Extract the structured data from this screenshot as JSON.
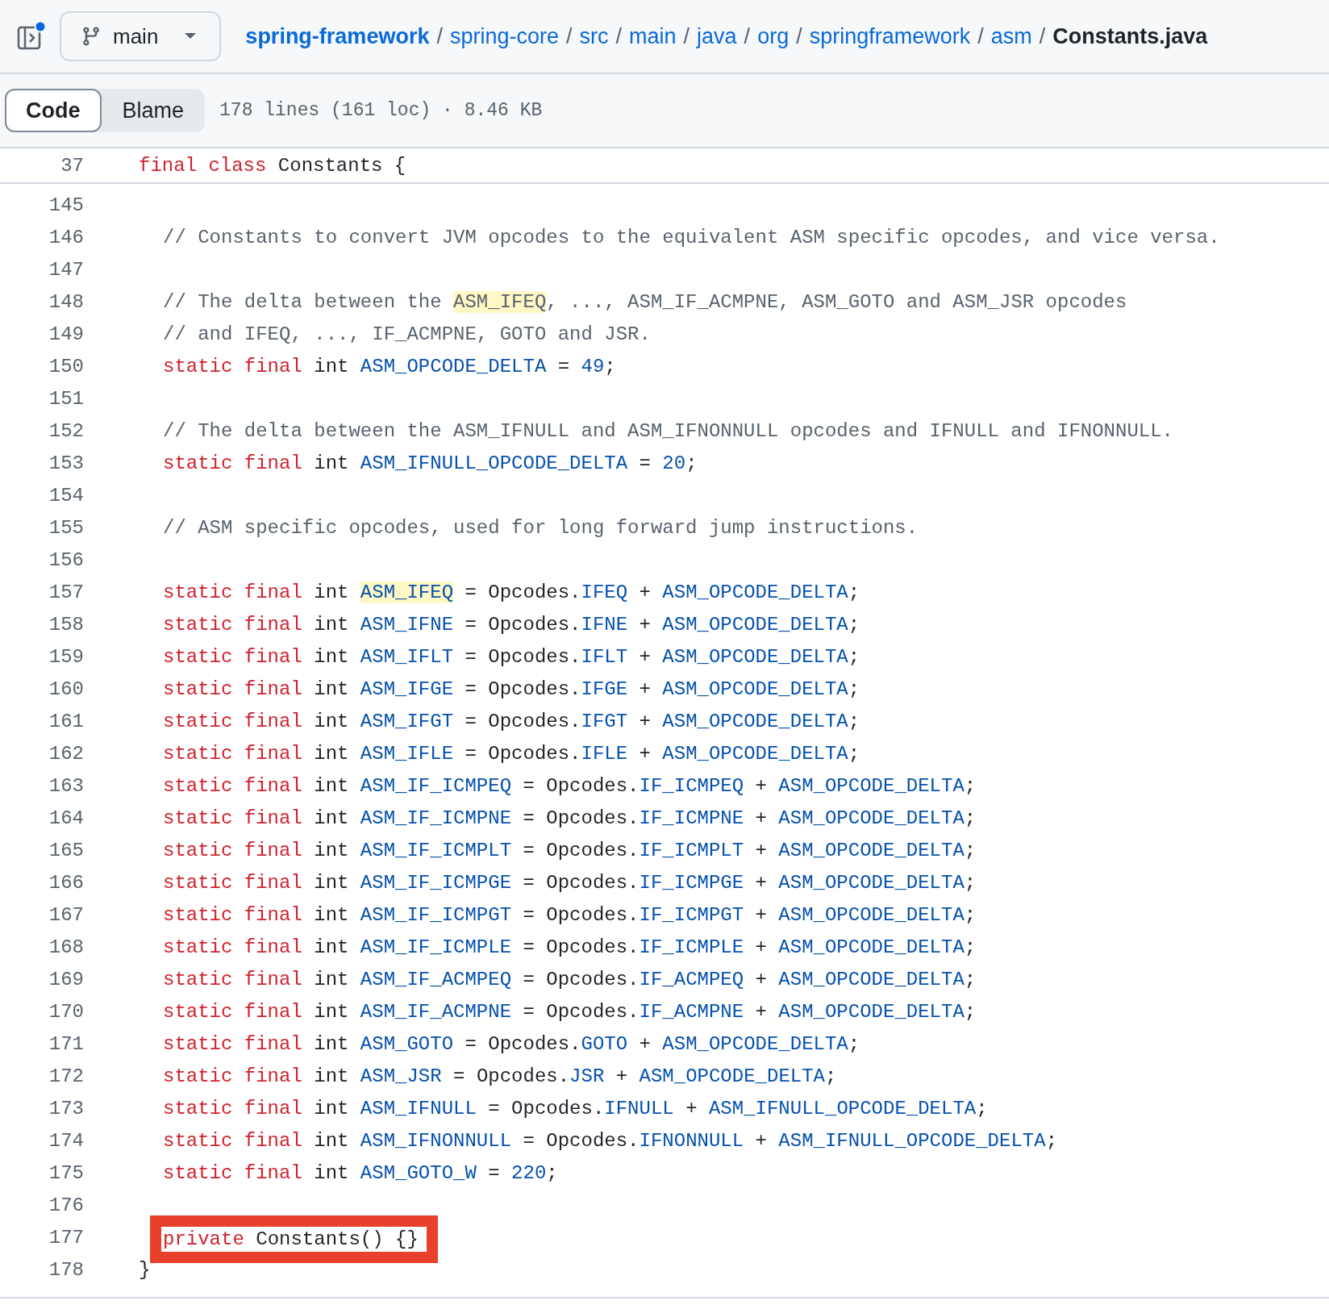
{
  "header": {
    "branch": {
      "label": "main"
    },
    "breadcrumb": [
      {
        "kind": "repo",
        "text": "spring-framework"
      },
      {
        "kind": "sep",
        "text": "/"
      },
      {
        "kind": "dir",
        "text": "spring-core"
      },
      {
        "kind": "sep",
        "text": "/"
      },
      {
        "kind": "dir",
        "text": "src"
      },
      {
        "kind": "sep",
        "text": "/"
      },
      {
        "kind": "dir",
        "text": "main"
      },
      {
        "kind": "sep",
        "text": "/"
      },
      {
        "kind": "dir",
        "text": "java"
      },
      {
        "kind": "sep",
        "text": "/"
      },
      {
        "kind": "dir",
        "text": "org"
      },
      {
        "kind": "sep",
        "text": "/"
      },
      {
        "kind": "dir",
        "text": "springframework"
      },
      {
        "kind": "sep",
        "text": "/"
      },
      {
        "kind": "dir",
        "text": "asm"
      },
      {
        "kind": "sep",
        "text": "/"
      },
      {
        "kind": "file",
        "text": "Constants.java"
      }
    ]
  },
  "tabs": [
    {
      "label": "Code",
      "selected": true
    },
    {
      "label": "Blame",
      "selected": false
    }
  ],
  "file_info": "178 lines (161 loc) · 8.46 KB",
  "sticky_line": {
    "number": "37",
    "tokens": [
      {
        "kind": "kw",
        "text": "final class"
      },
      {
        "kind": "plain",
        "text": " Constants {"
      }
    ]
  },
  "lines": [
    {
      "number": "145",
      "kind": "body"
    },
    {
      "number": "146",
      "kind": "body",
      "tokens": [
        {
          "kind": "comment",
          "text": "// Constants to convert JVM opcodes to the equivalent ASM specific opcodes, and vice versa."
        }
      ]
    },
    {
      "number": "147",
      "kind": "body"
    },
    {
      "number": "148",
      "kind": "body",
      "tokens": [
        {
          "kind": "comment",
          "text": "// The delta between the "
        },
        {
          "kind": "comment",
          "text": "ASM_IFEQ",
          "highlighted": true
        },
        {
          "kind": "comment",
          "text": ", ..., ASM_IF_ACMPNE, ASM_GOTO and ASM_JSR opcodes"
        }
      ]
    },
    {
      "number": "149",
      "kind": "body",
      "tokens": [
        {
          "kind": "comment",
          "text": "// and IFEQ, ..., IF_ACMPNE, GOTO and JSR."
        }
      ]
    },
    {
      "number": "150",
      "kind": "body",
      "tokens": [
        {
          "kind": "kw",
          "text": "static final"
        },
        {
          "kind": "plain",
          "text": " int "
        },
        {
          "kind": "const",
          "text": "ASM_OPCODE_DELTA"
        },
        {
          "kind": "plain",
          "text": " = "
        },
        {
          "kind": "const",
          "text": "49"
        },
        {
          "kind": "plain",
          "text": ";"
        }
      ]
    },
    {
      "number": "151",
      "kind": "body"
    },
    {
      "number": "152",
      "kind": "body",
      "tokens": [
        {
          "kind": "comment",
          "text": "// The delta between the ASM_IFNULL and ASM_IFNONNULL opcodes and IFNULL and IFNONNULL."
        }
      ]
    },
    {
      "number": "153",
      "kind": "body",
      "tokens": [
        {
          "kind": "kw",
          "text": "static final"
        },
        {
          "kind": "plain",
          "text": " int "
        },
        {
          "kind": "const",
          "text": "ASM_IFNULL_OPCODE_DELTA"
        },
        {
          "kind": "plain",
          "text": " = "
        },
        {
          "kind": "const",
          "text": "20"
        },
        {
          "kind": "plain",
          "text": ";"
        }
      ]
    },
    {
      "number": "154",
      "kind": "body"
    },
    {
      "number": "155",
      "kind": "body",
      "tokens": [
        {
          "kind": "comment",
          "text": "// ASM specific opcodes, used for long forward jump instructions."
        }
      ]
    },
    {
      "number": "156",
      "kind": "body"
    },
    {
      "number": "157",
      "kind": "body",
      "tokens": [
        {
          "kind": "kw",
          "text": "static final"
        },
        {
          "kind": "plain",
          "text": " int "
        },
        {
          "kind": "const",
          "text": "ASM_IFEQ",
          "highlighted": true
        },
        {
          "kind": "plain",
          "text": " = Opcodes."
        },
        {
          "kind": "const",
          "text": "IFEQ"
        },
        {
          "kind": "plain",
          "text": " + "
        },
        {
          "kind": "const",
          "text": "ASM_OPCODE_DELTA"
        },
        {
          "kind": "plain",
          "text": ";"
        }
      ]
    },
    {
      "number": "158",
      "kind": "body",
      "tokens": [
        {
          "kind": "kw",
          "text": "static final"
        },
        {
          "kind": "plain",
          "text": " int "
        },
        {
          "kind": "const",
          "text": "ASM_IFNE"
        },
        {
          "kind": "plain",
          "text": " = Opcodes."
        },
        {
          "kind": "const",
          "text": "IFNE"
        },
        {
          "kind": "plain",
          "text": " + "
        },
        {
          "kind": "const",
          "text": "ASM_OPCODE_DELTA"
        },
        {
          "kind": "plain",
          "text": ";"
        }
      ]
    },
    {
      "number": "159",
      "kind": "body",
      "tokens": [
        {
          "kind": "kw",
          "text": "static final"
        },
        {
          "kind": "plain",
          "text": " int "
        },
        {
          "kind": "const",
          "text": "ASM_IFLT"
        },
        {
          "kind": "plain",
          "text": " = Opcodes."
        },
        {
          "kind": "const",
          "text": "IFLT"
        },
        {
          "kind": "plain",
          "text": " + "
        },
        {
          "kind": "const",
          "text": "ASM_OPCODE_DELTA"
        },
        {
          "kind": "plain",
          "text": ";"
        }
      ]
    },
    {
      "number": "160",
      "kind": "body",
      "tokens": [
        {
          "kind": "kw",
          "text": "static final"
        },
        {
          "kind": "plain",
          "text": " int "
        },
        {
          "kind": "const",
          "text": "ASM_IFGE"
        },
        {
          "kind": "plain",
          "text": " = Opcodes."
        },
        {
          "kind": "const",
          "text": "IFGE"
        },
        {
          "kind": "plain",
          "text": " + "
        },
        {
          "kind": "const",
          "text": "ASM_OPCODE_DELTA"
        },
        {
          "kind": "plain",
          "text": ";"
        }
      ]
    },
    {
      "number": "161",
      "kind": "body",
      "tokens": [
        {
          "kind": "kw",
          "text": "static final"
        },
        {
          "kind": "plain",
          "text": " int "
        },
        {
          "kind": "const",
          "text": "ASM_IFGT"
        },
        {
          "kind": "plain",
          "text": " = Opcodes."
        },
        {
          "kind": "const",
          "text": "IFGT"
        },
        {
          "kind": "plain",
          "text": " + "
        },
        {
          "kind": "const",
          "text": "ASM_OPCODE_DELTA"
        },
        {
          "kind": "plain",
          "text": ";"
        }
      ]
    },
    {
      "number": "162",
      "kind": "body",
      "tokens": [
        {
          "kind": "kw",
          "text": "static final"
        },
        {
          "kind": "plain",
          "text": " int "
        },
        {
          "kind": "const",
          "text": "ASM_IFLE"
        },
        {
          "kind": "plain",
          "text": " = Opcodes."
        },
        {
          "kind": "const",
          "text": "IFLE"
        },
        {
          "kind": "plain",
          "text": " + "
        },
        {
          "kind": "const",
          "text": "ASM_OPCODE_DELTA"
        },
        {
          "kind": "plain",
          "text": ";"
        }
      ]
    },
    {
      "number": "163",
      "kind": "body",
      "tokens": [
        {
          "kind": "kw",
          "text": "static final"
        },
        {
          "kind": "plain",
          "text": " int "
        },
        {
          "kind": "const",
          "text": "ASM_IF_ICMPEQ"
        },
        {
          "kind": "plain",
          "text": " = Opcodes."
        },
        {
          "kind": "const",
          "text": "IF_ICMPEQ"
        },
        {
          "kind": "plain",
          "text": " + "
        },
        {
          "kind": "const",
          "text": "ASM_OPCODE_DELTA"
        },
        {
          "kind": "plain",
          "text": ";"
        }
      ]
    },
    {
      "number": "164",
      "kind": "body",
      "tokens": [
        {
          "kind": "kw",
          "text": "static final"
        },
        {
          "kind": "plain",
          "text": " int "
        },
        {
          "kind": "const",
          "text": "ASM_IF_ICMPNE"
        },
        {
          "kind": "plain",
          "text": " = Opcodes."
        },
        {
          "kind": "const",
          "text": "IF_ICMPNE"
        },
        {
          "kind": "plain",
          "text": " + "
        },
        {
          "kind": "const",
          "text": "ASM_OPCODE_DELTA"
        },
        {
          "kind": "plain",
          "text": ";"
        }
      ]
    },
    {
      "number": "165",
      "kind": "body",
      "tokens": [
        {
          "kind": "kw",
          "text": "static final"
        },
        {
          "kind": "plain",
          "text": " int "
        },
        {
          "kind": "const",
          "text": "ASM_IF_ICMPLT"
        },
        {
          "kind": "plain",
          "text": " = Opcodes."
        },
        {
          "kind": "const",
          "text": "IF_ICMPLT"
        },
        {
          "kind": "plain",
          "text": " + "
        },
        {
          "kind": "const",
          "text": "ASM_OPCODE_DELTA"
        },
        {
          "kind": "plain",
          "text": ";"
        }
      ]
    },
    {
      "number": "166",
      "kind": "body",
      "tokens": [
        {
          "kind": "kw",
          "text": "static final"
        },
        {
          "kind": "plain",
          "text": " int "
        },
        {
          "kind": "const",
          "text": "ASM_IF_ICMPGE"
        },
        {
          "kind": "plain",
          "text": " = Opcodes."
        },
        {
          "kind": "const",
          "text": "IF_ICMPGE"
        },
        {
          "kind": "plain",
          "text": " + "
        },
        {
          "kind": "const",
          "text": "ASM_OPCODE_DELTA"
        },
        {
          "kind": "plain",
          "text": ";"
        }
      ]
    },
    {
      "number": "167",
      "kind": "body",
      "tokens": [
        {
          "kind": "kw",
          "text": "static final"
        },
        {
          "kind": "plain",
          "text": " int "
        },
        {
          "kind": "const",
          "text": "ASM_IF_ICMPGT"
        },
        {
          "kind": "plain",
          "text": " = Opcodes."
        },
        {
          "kind": "const",
          "text": "IF_ICMPGT"
        },
        {
          "kind": "plain",
          "text": " + "
        },
        {
          "kind": "const",
          "text": "ASM_OPCODE_DELTA"
        },
        {
          "kind": "plain",
          "text": ";"
        }
      ]
    },
    {
      "number": "168",
      "kind": "body",
      "tokens": [
        {
          "kind": "kw",
          "text": "static final"
        },
        {
          "kind": "plain",
          "text": " int "
        },
        {
          "kind": "const",
          "text": "ASM_IF_ICMPLE"
        },
        {
          "kind": "plain",
          "text": " = Opcodes."
        },
        {
          "kind": "const",
          "text": "IF_ICMPLE"
        },
        {
          "kind": "plain",
          "text": " + "
        },
        {
          "kind": "const",
          "text": "ASM_OPCODE_DELTA"
        },
        {
          "kind": "plain",
          "text": ";"
        }
      ]
    },
    {
      "number": "169",
      "kind": "body",
      "tokens": [
        {
          "kind": "kw",
          "text": "static final"
        },
        {
          "kind": "plain",
          "text": " int "
        },
        {
          "kind": "const",
          "text": "ASM_IF_ACMPEQ"
        },
        {
          "kind": "plain",
          "text": " = Opcodes."
        },
        {
          "kind": "const",
          "text": "IF_ACMPEQ"
        },
        {
          "kind": "plain",
          "text": " + "
        },
        {
          "kind": "const",
          "text": "ASM_OPCODE_DELTA"
        },
        {
          "kind": "plain",
          "text": ";"
        }
      ]
    },
    {
      "number": "170",
      "kind": "body",
      "tokens": [
        {
          "kind": "kw",
          "text": "static final"
        },
        {
          "kind": "plain",
          "text": " int "
        },
        {
          "kind": "const",
          "text": "ASM_IF_ACMPNE"
        },
        {
          "kind": "plain",
          "text": " = Opcodes."
        },
        {
          "kind": "const",
          "text": "IF_ACMPNE"
        },
        {
          "kind": "plain",
          "text": " + "
        },
        {
          "kind": "const",
          "text": "ASM_OPCODE_DELTA"
        },
        {
          "kind": "plain",
          "text": ";"
        }
      ]
    },
    {
      "number": "171",
      "kind": "body",
      "tokens": [
        {
          "kind": "kw",
          "text": "static final"
        },
        {
          "kind": "plain",
          "text": " int "
        },
        {
          "kind": "const",
          "text": "ASM_GOTO"
        },
        {
          "kind": "plain",
          "text": " = Opcodes."
        },
        {
          "kind": "const",
          "text": "GOTO"
        },
        {
          "kind": "plain",
          "text": " + "
        },
        {
          "kind": "const",
          "text": "ASM_OPCODE_DELTA"
        },
        {
          "kind": "plain",
          "text": ";"
        }
      ]
    },
    {
      "number": "172",
      "kind": "body",
      "tokens": [
        {
          "kind": "kw",
          "text": "static final"
        },
        {
          "kind": "plain",
          "text": " int "
        },
        {
          "kind": "const",
          "text": "ASM_JSR"
        },
        {
          "kind": "plain",
          "text": " = Opcodes."
        },
        {
          "kind": "const",
          "text": "JSR"
        },
        {
          "kind": "plain",
          "text": " + "
        },
        {
          "kind": "const",
          "text": "ASM_OPCODE_DELTA"
        },
        {
          "kind": "plain",
          "text": ";"
        }
      ]
    },
    {
      "number": "173",
      "kind": "body",
      "tokens": [
        {
          "kind": "kw",
          "text": "static final"
        },
        {
          "kind": "plain",
          "text": " int "
        },
        {
          "kind": "const",
          "text": "ASM_IFNULL"
        },
        {
          "kind": "plain",
          "text": " = Opcodes."
        },
        {
          "kind": "const",
          "text": "IFNULL"
        },
        {
          "kind": "plain",
          "text": " + "
        },
        {
          "kind": "const",
          "text": "ASM_IFNULL_OPCODE_DELTA"
        },
        {
          "kind": "plain",
          "text": ";"
        }
      ]
    },
    {
      "number": "174",
      "kind": "body",
      "tokens": [
        {
          "kind": "kw",
          "text": "static final"
        },
        {
          "kind": "plain",
          "text": " int "
        },
        {
          "kind": "const",
          "text": "ASM_IFNONNULL"
        },
        {
          "kind": "plain",
          "text": " = Opcodes."
        },
        {
          "kind": "const",
          "text": "IFNONNULL"
        },
        {
          "kind": "plain",
          "text": " + "
        },
        {
          "kind": "const",
          "text": "ASM_IFNULL_OPCODE_DELTA"
        },
        {
          "kind": "plain",
          "text": ";"
        }
      ]
    },
    {
      "number": "175",
      "kind": "body",
      "tokens": [
        {
          "kind": "kw",
          "text": "static final"
        },
        {
          "kind": "plain",
          "text": " int "
        },
        {
          "kind": "const",
          "text": "ASM_GOTO_W"
        },
        {
          "kind": "plain",
          "text": " = "
        },
        {
          "kind": "const",
          "text": "220"
        },
        {
          "kind": "plain",
          "text": ";"
        }
      ]
    },
    {
      "number": "176",
      "kind": "body"
    },
    {
      "number": "177",
      "kind": "body",
      "annotated": true,
      "tokens": [
        {
          "kind": "kw",
          "text": "private"
        },
        {
          "kind": "plain",
          "text": " Constants() {}"
        }
      ]
    },
    {
      "number": "178",
      "kind": "closing",
      "tokens": [
        {
          "kind": "plain",
          "text": "}"
        }
      ]
    }
  ]
}
